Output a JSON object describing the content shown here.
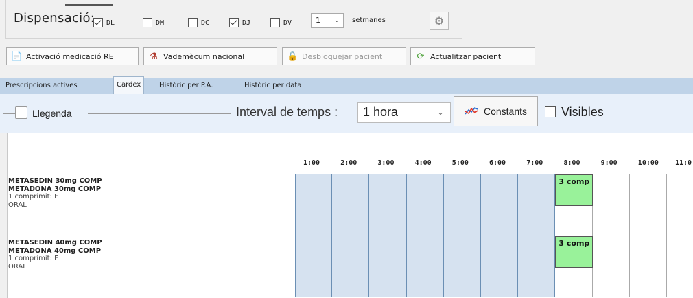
{
  "dispensacio": {
    "label": "Dispensació:",
    "days": [
      {
        "code": "DL",
        "checked": true
      },
      {
        "code": "DM",
        "checked": false
      },
      {
        "code": "DC",
        "checked": false
      },
      {
        "code": "DJ",
        "checked": true
      },
      {
        "code": "DV",
        "checked": false
      }
    ],
    "weeks_value": "1",
    "weeks_unit": "setmanes",
    "settings_icon": "gear-icon"
  },
  "toolbar": {
    "activacio": "Activació medicació RE",
    "vademecum": "Vademècum nacional",
    "desbloquejar": "Desbloquejar pacient",
    "actualitzar": "Actualitzar pacient"
  },
  "tabs": [
    {
      "label": "Prescripcions actives",
      "active": false
    },
    {
      "label": "Cardex",
      "active": true
    },
    {
      "label": "Històric per P.A.",
      "active": false
    },
    {
      "label": "Històric per data",
      "active": false
    }
  ],
  "controls": {
    "legend_label": "Llegenda",
    "interval_label": "Interval de temps :",
    "interval_value": "1 hora",
    "constants_label": "Constants",
    "visibles_label": "Visibles"
  },
  "hours": [
    "1:00",
    "2:00",
    "3:00",
    "4:00",
    "5:00",
    "6:00",
    "7:00",
    "8:00",
    "9:00",
    "10:00",
    "11:0"
  ],
  "current_hour": "8:00",
  "medications": [
    {
      "name1": "METASEDIN 30mg COMP",
      "name2": "METADONA 30mg COMP",
      "dose": "1 comprimit: E",
      "route": "ORAL",
      "scheduled": {
        "hour": "8:00",
        "label": "3 comp"
      }
    },
    {
      "name1": "METASEDIN 40mg COMP",
      "name2": "METADONA 40mg COMP",
      "dose": "1 comprimit: E",
      "route": "ORAL",
      "scheduled": {
        "hour": "8:00",
        "label": "3 comp"
      }
    }
  ],
  "colors": {
    "past_cell": "#d6e2f0",
    "dose_cell": "#99f29a",
    "tab_strip": "#bfd3e8"
  }
}
